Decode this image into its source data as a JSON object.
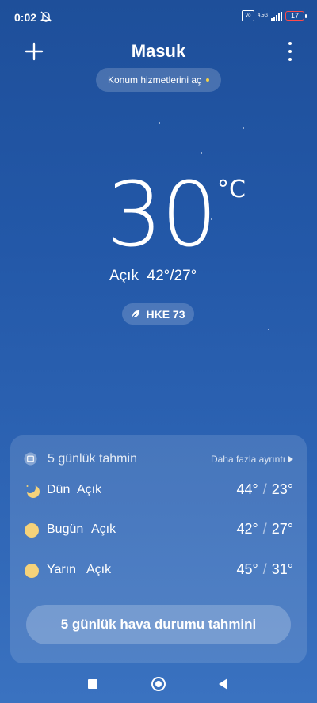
{
  "status_bar": {
    "time": "0:02",
    "network": "4.5G",
    "battery": "17"
  },
  "header": {
    "city": "Masuk",
    "location_prompt": "Konum hizmetlerini aç"
  },
  "current": {
    "temperature": "30",
    "unit": "°C",
    "summary": "Açık  42°/27°",
    "aqi": "HKE 73"
  },
  "forecast_card": {
    "title": "5 günlük tahmin",
    "more_link": "Daha fazla ayrıntı",
    "rows": [
      {
        "day": "Dün",
        "condition": "Açık",
        "high": "44°",
        "low": "23°",
        "icon": "moon-icon"
      },
      {
        "day": "Bugün",
        "condition": "Açık",
        "high": "42°",
        "low": "27°",
        "icon": "sun-icon"
      },
      {
        "day": "Yarın",
        "condition": "Açık",
        "high": "45°",
        "low": "31°",
        "icon": "sun-icon"
      }
    ],
    "button_label": "5 günlük hava durumu tahmini"
  },
  "colors": {
    "background_top": "#1e4f9a",
    "background_bottom": "#3a72c0",
    "sun": "#f5d27a",
    "location_dot": "#f6d146"
  }
}
